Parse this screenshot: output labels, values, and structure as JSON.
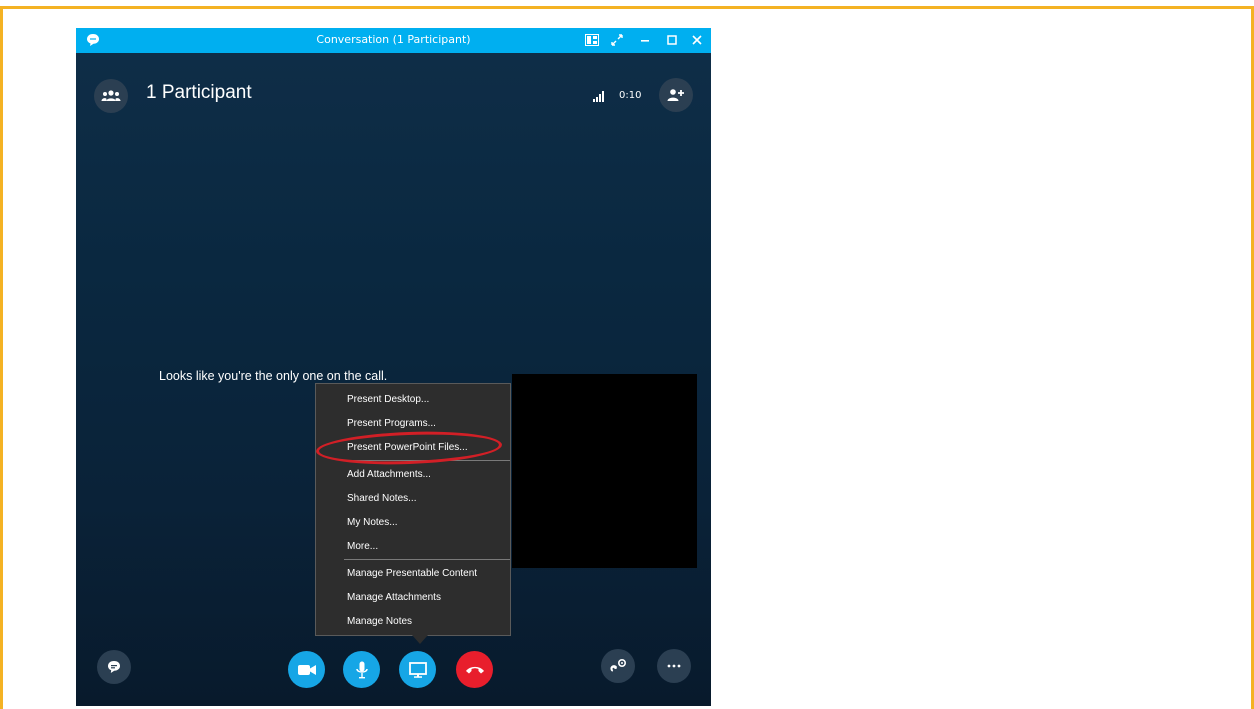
{
  "window": {
    "title": "Conversation (1 Participant)"
  },
  "header": {
    "participants_label": "1 Participant",
    "timer": "0:10"
  },
  "stage": {
    "message": "Looks like you're the only one on the call."
  },
  "present_menu": {
    "items": [
      {
        "label": "Present Desktop..."
      },
      {
        "label": "Present Programs..."
      },
      {
        "label": "Present PowerPoint Files..."
      },
      {
        "label": "Add Attachments..."
      },
      {
        "label": "Shared Notes..."
      },
      {
        "label": "My Notes..."
      },
      {
        "label": "More..."
      },
      {
        "label": "Manage Presentable Content"
      },
      {
        "label": "Manage Attachments"
      },
      {
        "label": "Manage Notes"
      }
    ],
    "highlighted": "Present PowerPoint Files..."
  },
  "colors": {
    "frame_border": "#f4b223",
    "titlebar": "#00aff0",
    "call_button": "#16a6e6",
    "hangup_button": "#e81e2c",
    "highlight_ellipse": "#d21f26"
  },
  "icons": [
    "skype-logo-icon",
    "snap-layout-icon",
    "fullscreen-icon",
    "minimize-icon",
    "maximize-icon",
    "close-icon",
    "participants-icon",
    "signal-strength-icon",
    "add-participant-icon",
    "chat-icon",
    "video-icon",
    "microphone-icon",
    "present-screen-icon",
    "hang-up-icon",
    "call-controls-icon",
    "more-options-icon"
  ]
}
